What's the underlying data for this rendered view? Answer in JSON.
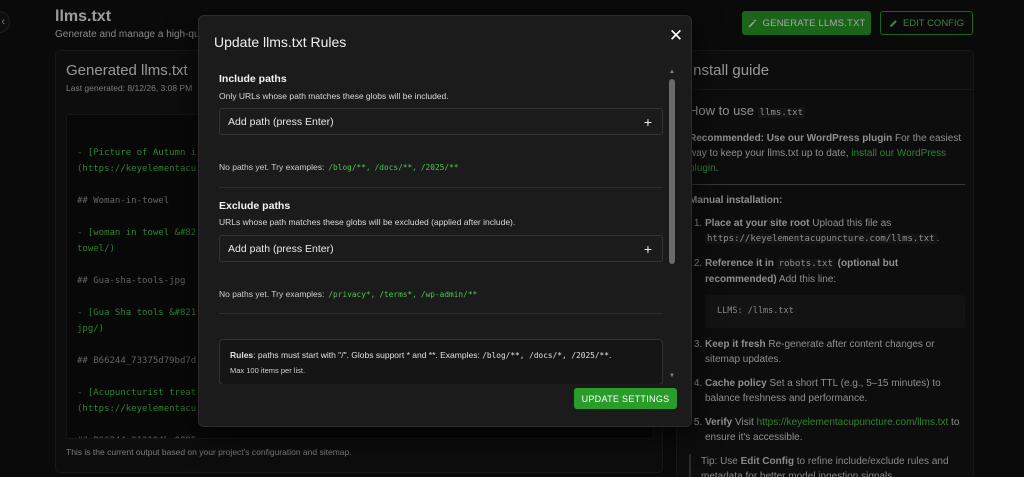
{
  "header": {
    "title": "llms.txt",
    "subtitle": "Generate and manage a high-quality",
    "generate_label": "GENERATE LLMS.TXT",
    "edit_label": "EDIT CONFIG",
    "back_icon": "chevron-left-icon"
  },
  "generated": {
    "title": "Generated llms.txt",
    "meta": "Last generated: 8/12/26, 3:08 PM",
    "footer": "This is the current output based on your project's configuration and sitemap.",
    "lines": [
      {
        "text": "- [Picture of Autumn i",
        "kind": "link"
      },
      {
        "text": "(https://keyelementacu",
        "kind": "link"
      },
      {
        "text": "",
        "kind": "blank"
      },
      {
        "text": "## Woman-in-towel",
        "kind": "head"
      },
      {
        "text": "",
        "kind": "blank"
      },
      {
        "text": "- [woman in towel &#82",
        "kind": "link"
      },
      {
        "text": "towel/)",
        "kind": "link"
      },
      {
        "text": "",
        "kind": "blank"
      },
      {
        "text": "## Gua-sha-tools-jpg",
        "kind": "head"
      },
      {
        "text": "",
        "kind": "blank"
      },
      {
        "text": "- [Gua Sha tools &#821",
        "kind": "link"
      },
      {
        "text": "jpg/)",
        "kind": "link"
      },
      {
        "text": "",
        "kind": "blank"
      },
      {
        "text": "## B66244_73375d79bd7d",
        "kind": "head"
      },
      {
        "text": "",
        "kind": "blank"
      },
      {
        "text": "- [Acupuncturist treat",
        "kind": "link"
      },
      {
        "text": "(https://keyelementacu",
        "kind": "link"
      },
      {
        "text": "",
        "kind": "blank"
      },
      {
        "text": "## B66244_213194be0895",
        "kind": "head"
      }
    ]
  },
  "guide": {
    "title": "Install guide",
    "how_to_prefix": "How to use",
    "how_to_code": "llms.txt",
    "recommended_bold": "Recommended: Use our WordPress plugin",
    "recommended_text": " For the easiest way to keep your llms.txt up to date, ",
    "recommended_link": "install our WordPress plugin",
    "recommended_end": ".",
    "manual_title": "Manual installation:",
    "step1_bold": "Place at your site root",
    "step1_text": " Upload this file as ",
    "step1_code": "https://keyelementacupuncture.com/llms.txt",
    "step1_end": ".",
    "step2_bold_a": "Reference it in ",
    "step2_code": "robots.txt",
    "step2_bold_b": " (optional but recommended)",
    "step2_text": " Add this line:",
    "step2_snippet": "LLMS: /llms.txt",
    "step3_bold": "Keep it fresh",
    "step3_text": " Re-generate after content changes or sitemap updates.",
    "step4_bold": "Cache policy",
    "step4_text": " Set a short TTL (e.g., 5–15 minutes) to balance freshness and performance.",
    "step5_bold": "Verify",
    "step5_text_a": " Visit ",
    "step5_link": "https://keyelementacupuncture.com/llms.txt",
    "step5_text_b": " to ensure it's accessible.",
    "tip_a": "Tip: Use ",
    "tip_bold": "Edit Config",
    "tip_b": " to refine include/exclude rules and metadata for better model ingestion signals."
  },
  "modal": {
    "title": "Update llms.txt Rules",
    "close_icon": "close-icon",
    "include": {
      "title": "Include paths",
      "desc": "Only URLs whose path matches these globs will be included.",
      "placeholder": "Add path (press Enter)",
      "hint": "No paths yet. Try examples:",
      "examples": [
        "/blog/**,",
        "/docs/**,",
        "/2025/**"
      ]
    },
    "exclude": {
      "title": "Exclude paths",
      "desc": "URLs whose path matches these globs will be excluded (applied after include).",
      "placeholder": "Add path (press Enter)",
      "hint": "No paths yet. Try examples:",
      "examples": [
        "/privacy*,",
        "/terms*,",
        "/wp-admin/**"
      ]
    },
    "rules": {
      "bold": "Rules",
      "text": ": paths must start with \"/\". Globs support * and **. Examples: ",
      "examples": "/blog/**, /docs/*, /2025/**",
      "end": ".",
      "limit": "Max 100 items per list."
    },
    "update_label": "UPDATE SETTINGS"
  },
  "colors": {
    "accent": "#2a9c2a",
    "link": "#4dc64d",
    "modal_bg": "#1b1b1b",
    "page_bg": "#101010"
  }
}
